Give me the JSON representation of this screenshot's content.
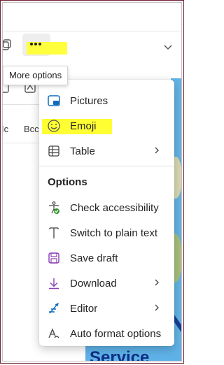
{
  "toolbar": {
    "more_icon": "ellipsis-icon",
    "expand_icon": "chevron-down-icon"
  },
  "tooltip": {
    "text": "More options"
  },
  "background": {
    "fragment_1": "Ic",
    "fragment_2": "Bcc"
  },
  "promo": {
    "text": "Service"
  },
  "menu": {
    "insert_items": [
      {
        "label": "Pictures",
        "icon": "pictures-icon",
        "submenu": false
      },
      {
        "label": "Emoji",
        "icon": "emoji-icon",
        "submenu": false
      },
      {
        "label": "Table",
        "icon": "table-icon",
        "submenu": true
      }
    ],
    "options_heading": "Options",
    "options_items": [
      {
        "label": "Check accessibility",
        "icon": "accessibility-check-icon",
        "submenu": false
      },
      {
        "label": "Switch to plain text",
        "icon": "plain-text-icon",
        "submenu": false
      },
      {
        "label": "Save draft",
        "icon": "save-icon",
        "submenu": false
      },
      {
        "label": "Download",
        "icon": "download-icon",
        "submenu": true
      },
      {
        "label": "Editor",
        "icon": "editor-icon",
        "submenu": true
      },
      {
        "label": "Auto format options",
        "icon": "auto-format-icon",
        "submenu": false
      }
    ]
  },
  "colors": {
    "highlight": "#ffff33",
    "accent_blue": "#0f6cbd",
    "frame": "#6b1f32",
    "save_purple": "#8a3fb5"
  }
}
